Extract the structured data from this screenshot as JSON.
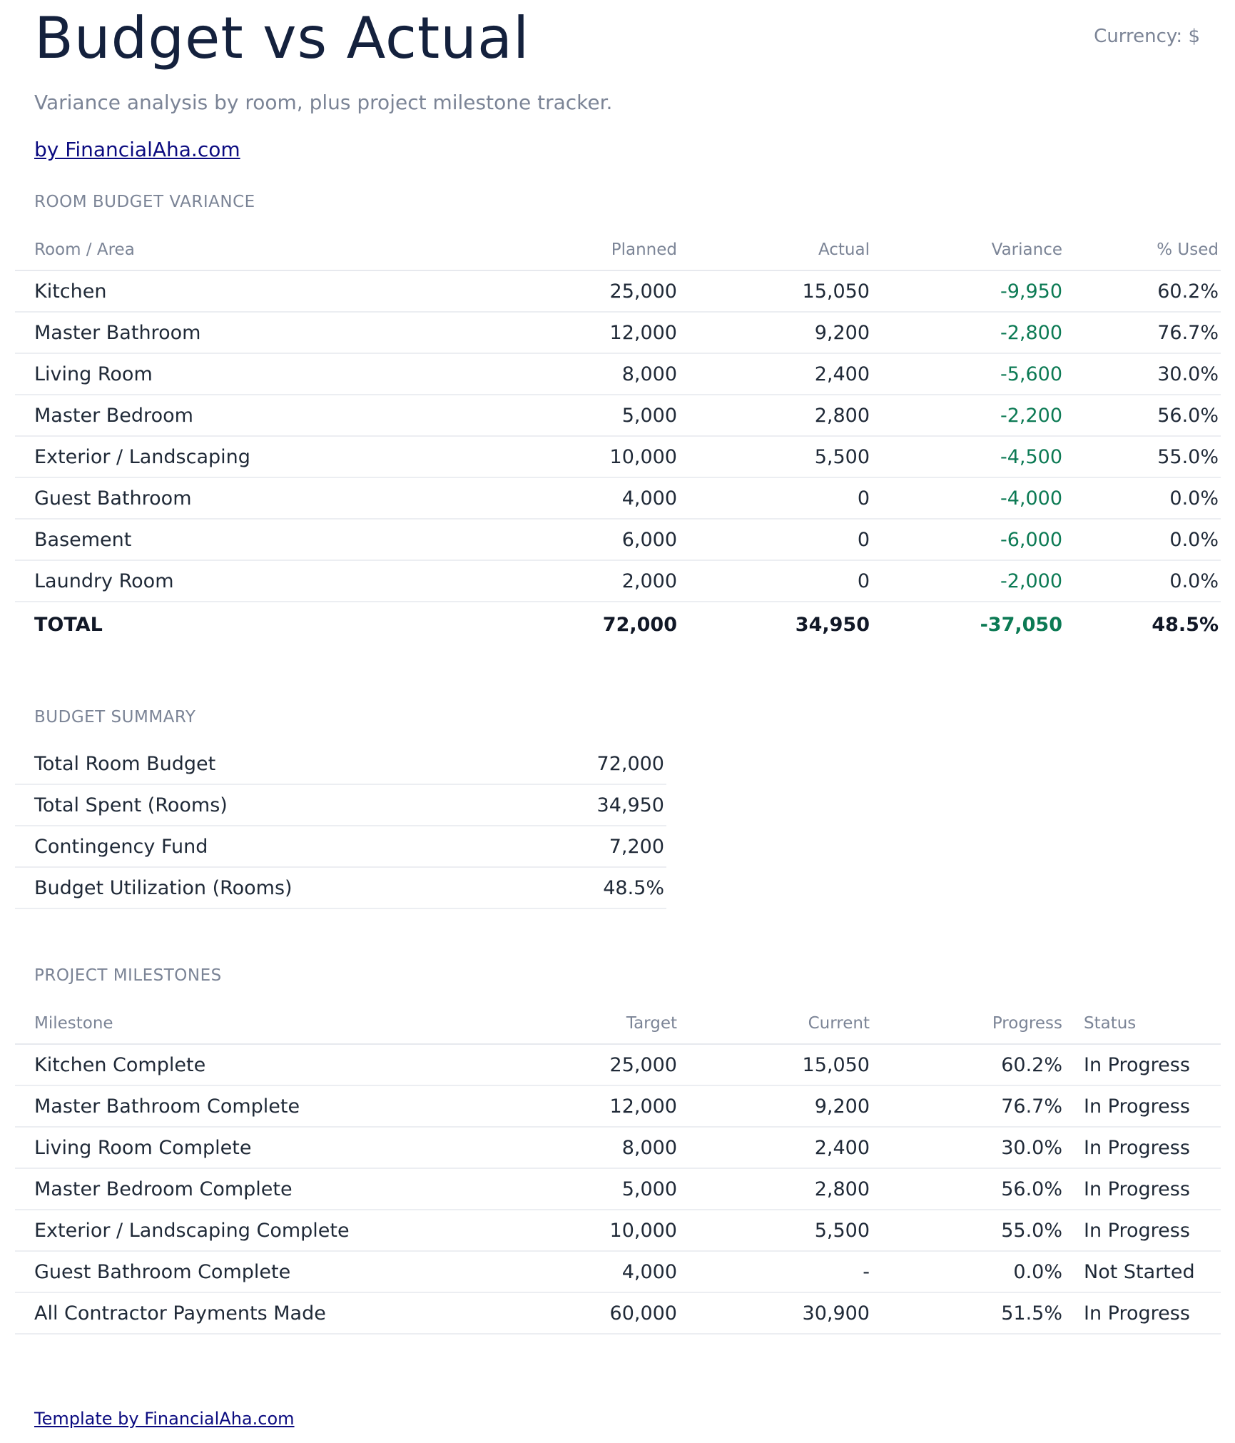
{
  "header": {
    "title": "Budget vs Actual",
    "currency": "Currency: $",
    "subtitle": "Variance analysis by room, plus project milestone tracker.",
    "credit_link": "by FinancialAha.com"
  },
  "room_variance": {
    "section_label": "ROOM BUDGET VARIANCE",
    "columns": [
      "Room / Area",
      "Planned",
      "Actual",
      "Variance",
      "% Used"
    ],
    "rows": [
      [
        "Kitchen",
        "25,000",
        "15,050",
        "-9,950",
        "60.2%"
      ],
      [
        "Master Bathroom",
        "12,000",
        "9,200",
        "-2,800",
        "76.7%"
      ],
      [
        "Living Room",
        "8,000",
        "2,400",
        "-5,600",
        "30.0%"
      ],
      [
        "Master Bedroom",
        "5,000",
        "2,800",
        "-2,200",
        "56.0%"
      ],
      [
        "Exterior / Landscaping",
        "10,000",
        "5,500",
        "-4,500",
        "55.0%"
      ],
      [
        "Guest Bathroom",
        "4,000",
        "0",
        "-4,000",
        "0.0%"
      ],
      [
        "Basement",
        "6,000",
        "0",
        "-6,000",
        "0.0%"
      ],
      [
        "Laundry Room",
        "2,000",
        "0",
        "-2,000",
        "0.0%"
      ]
    ],
    "total": [
      "TOTAL",
      "72,000",
      "34,950",
      "-37,050",
      "48.5%"
    ],
    "variance_color": "#0c7a54"
  },
  "budget_summary": {
    "section_label": "BUDGET SUMMARY",
    "rows": [
      [
        "Total Room Budget",
        "72,000"
      ],
      [
        "Total Spent (Rooms)",
        "34,950"
      ],
      [
        "Contingency Fund",
        "7,200"
      ],
      [
        "Budget Utilization (Rooms)",
        "48.5%"
      ]
    ]
  },
  "milestones": {
    "section_label": "PROJECT MILESTONES",
    "columns": [
      "Milestone",
      "Target",
      "Current",
      "Progress",
      "Status"
    ],
    "rows": [
      [
        "Kitchen Complete",
        "25,000",
        "15,050",
        "60.2%",
        "In Progress"
      ],
      [
        "Master Bathroom Complete",
        "12,000",
        "9,200",
        "76.7%",
        "In Progress"
      ],
      [
        "Living Room Complete",
        "8,000",
        "2,400",
        "30.0%",
        "In Progress"
      ],
      [
        "Master Bedroom Complete",
        "5,000",
        "2,800",
        "56.0%",
        "In Progress"
      ],
      [
        "Exterior / Landscaping Complete",
        "10,000",
        "5,500",
        "55.0%",
        "In Progress"
      ],
      [
        "Guest Bathroom Complete",
        "4,000",
        "-",
        "0.0%",
        "Not Started"
      ],
      [
        "All Contractor Payments Made",
        "60,000",
        "30,900",
        "51.5%",
        "In Progress"
      ]
    ]
  },
  "footer": {
    "link": "Template by FinancialAha.com"
  }
}
